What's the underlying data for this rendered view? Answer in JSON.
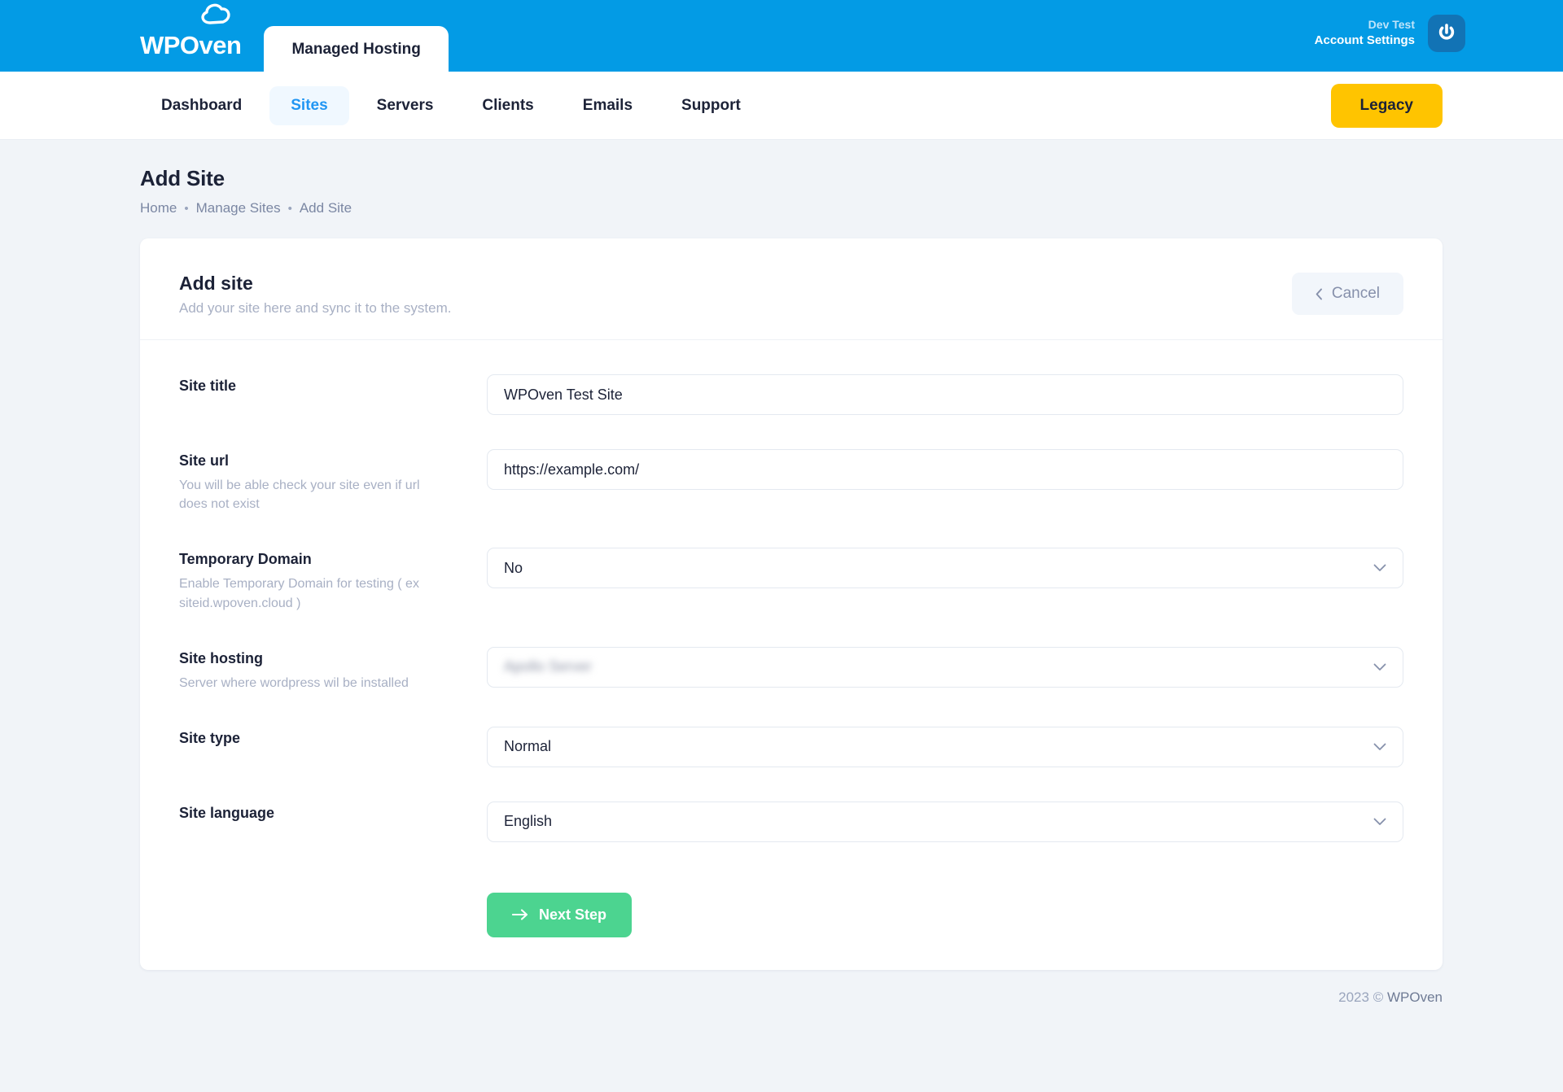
{
  "topbar": {
    "brand_name": "WPOven",
    "brand_logo_icon": "cloud-outline-icon",
    "managed_tab_label": "Managed Hosting",
    "account_user": "Dev Test",
    "account_settings_label": "Account Settings",
    "avatar_icon": "power-icon"
  },
  "nav": {
    "items": [
      {
        "label": "Dashboard",
        "active": false
      },
      {
        "label": "Sites",
        "active": true
      },
      {
        "label": "Servers",
        "active": false
      },
      {
        "label": "Clients",
        "active": false
      },
      {
        "label": "Emails",
        "active": false
      },
      {
        "label": "Support",
        "active": false
      }
    ],
    "legacy_label": "Legacy"
  },
  "page": {
    "title": "Add Site",
    "breadcrumb": [
      "Home",
      "Manage Sites",
      "Add Site"
    ],
    "breadcrumb_separator": "•"
  },
  "card": {
    "title": "Add site",
    "subtitle": "Add your site here and sync it to the system.",
    "cancel_label": "Cancel",
    "cancel_icon": "chevron-left-icon"
  },
  "form": {
    "fields": [
      {
        "label": "Site title",
        "help": "",
        "type": "text",
        "value": "WPOven Test Site",
        "placeholder": "Site title"
      },
      {
        "label": "Site url",
        "help": "You will be able check your site even if url does not exist",
        "type": "text",
        "value": "https://example.com/",
        "placeholder": "Site url"
      },
      {
        "label": "Temporary Domain",
        "help": "Enable Temporary Domain for testing ( ex siteid.wpoven.cloud )",
        "type": "select",
        "value": "No",
        "redacted": false
      },
      {
        "label": "Site hosting",
        "help": "Server where wordpress wil be installed",
        "type": "select",
        "value": "Apollo Server",
        "redacted": true
      },
      {
        "label": "Site type",
        "help": "",
        "type": "select",
        "value": "Normal",
        "redacted": false
      },
      {
        "label": "Site language",
        "help": "",
        "type": "select",
        "value": "English",
        "redacted": false
      }
    ],
    "submit_label": "Next Step",
    "submit_icon": "arrow-right-icon",
    "select_icon": "chevron-down-icon"
  },
  "footer": {
    "year": "2023",
    "copyright_symbol": "©",
    "company": "WPOven"
  },
  "colors": {
    "topbar_blue": "#039be5",
    "accent_blue": "#2196f3",
    "legacy_yellow": "#ffc400",
    "submit_green": "#4cd490",
    "page_bg": "#f1f4f8",
    "text_dark": "#1c2237",
    "muted": "#a8b0c4"
  }
}
